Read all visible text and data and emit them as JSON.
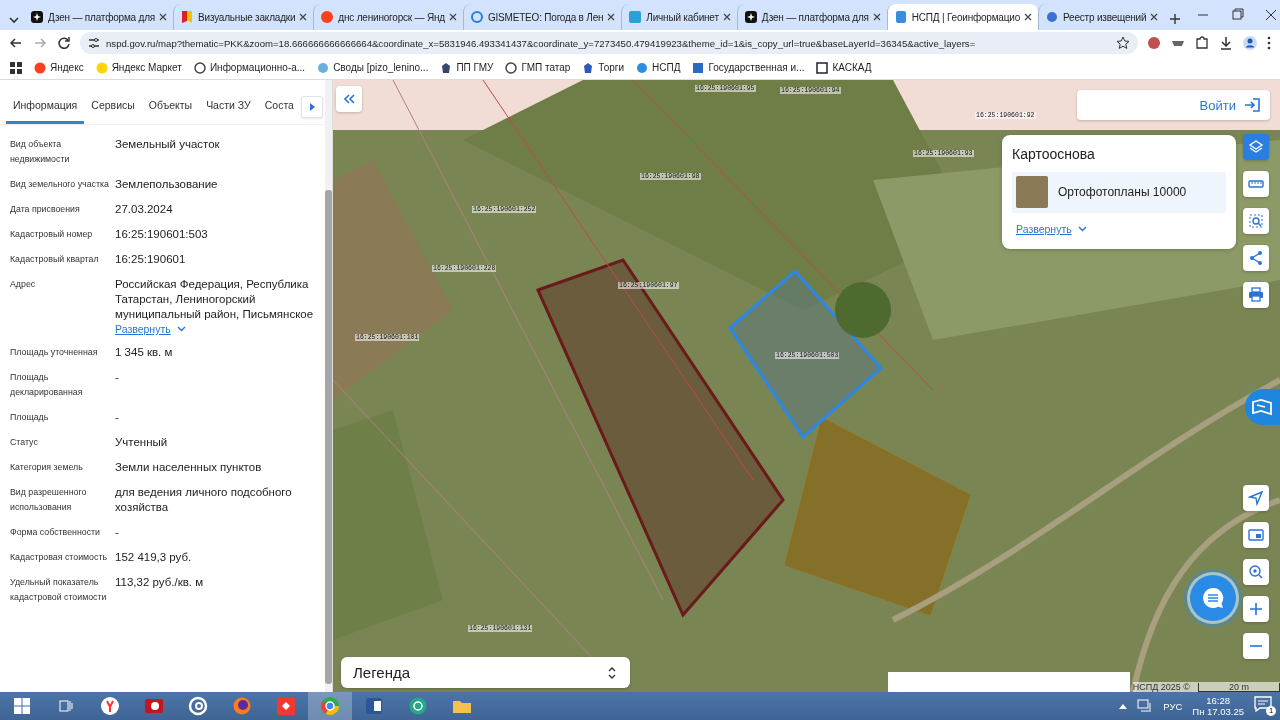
{
  "browser": {
    "tabs": [
      {
        "title": "Дзен — платформа для",
        "selected": false
      },
      {
        "title": "Визуальные закладки",
        "selected": false
      },
      {
        "title": "днс лениногорск — Янд",
        "selected": false
      },
      {
        "title": "GISMETEO: Погода в Лен",
        "selected": false
      },
      {
        "title": "Личный кабинет",
        "selected": false
      },
      {
        "title": "Дзен — платформа для",
        "selected": false
      },
      {
        "title": "НСПД | Геоинформацио",
        "selected": true
      },
      {
        "title": "Реестр извещений",
        "selected": false
      }
    ],
    "url": "nspd.gov.ru/map?thematic=PKK&zoom=18.666666666666664&coordinate_x=5831946.493341437&coordinate_y=7273450.479419923&theme_id=1&is_copy_url=true&baseLayerId=36345&active_layers=",
    "bookmarks": [
      "Яндекс",
      "Яндекс Маркет",
      "Информационно-а...",
      "Своды [pizo_lenino...",
      "ПП ГМУ",
      "ГМП татар",
      "Торги",
      "НСПД",
      "Государственная и...",
      "КАСКАД"
    ]
  },
  "panel": {
    "tabs": [
      {
        "label": "Информация",
        "selected": true
      },
      {
        "label": "Сервисы",
        "selected": false
      },
      {
        "label": "Объекты",
        "selected": false
      },
      {
        "label": "Части ЗУ",
        "selected": false
      },
      {
        "label": "Соста",
        "selected": false
      }
    ],
    "fields": [
      {
        "label": "Вид объекта недвижимости",
        "value": "Земельный участок"
      },
      {
        "label": "Вид земельного участка",
        "value": "Землепользование"
      },
      {
        "label": "Дата присвоения",
        "value": "27.03.2024"
      },
      {
        "label": "Кадастровый номер",
        "value": "16:25:190601:503"
      },
      {
        "label": "Кадастровый квартал",
        "value": "16:25:190601"
      },
      {
        "label": "Адрес",
        "value": "Российская Федерация, Республика Татарстан, Лениногорский муниципальный район, Письмянское",
        "link": "Развернуть"
      },
      {
        "label": "Площадь уточненная",
        "value": "1 345 кв. м"
      },
      {
        "label": "Площадь декларированная",
        "value": "-"
      },
      {
        "label": "Площадь",
        "value": "-"
      },
      {
        "label": "Статус",
        "value": "Учтенный"
      },
      {
        "label": "Категория земель",
        "value": "Земли населенных пунктов"
      },
      {
        "label": "Вид разрешенного использования",
        "value": "для ведения личного подсобного хозяйства"
      },
      {
        "label": "Форма собственности",
        "value": "-"
      },
      {
        "label": "Кадастровая стоимость",
        "value": "152 419,3 руб."
      },
      {
        "label": "Удельный показатель кадастровой стоимости",
        "value": "113,32 руб./кв. м"
      }
    ]
  },
  "map": {
    "login": "Войти",
    "basemap": {
      "title": "Картооснова",
      "layers": [
        {
          "name": "Ортофотопланы 10000",
          "selected": true
        }
      ],
      "expand": "Развернуть"
    },
    "tools": [
      {
        "kind": "layers",
        "selected": true
      },
      {
        "kind": "ruler",
        "selected": false
      },
      {
        "kind": "select",
        "selected": false
      },
      {
        "kind": "share",
        "selected": false
      },
      {
        "kind": "print",
        "selected": false
      }
    ],
    "parcel_labels": [
      "16:25:190601:95",
      "16:25:190601:94",
      "16:25:190601:93",
      "16:25:190601:92",
      "16:25:190601:98",
      "16:25:190601:252",
      "16:25:190601:228",
      "16:25:190601:97",
      "16:25:190601:101",
      "16:25:190601:503",
      "16:25:190601:131"
    ],
    "legend": "Легенда",
    "attribution": "НСПД 2025 ©",
    "scale": "20 m"
  },
  "taskbar": {
    "language": "РУС",
    "time": "16:28",
    "date": "Пн 17.03.25",
    "notifications": "1"
  }
}
